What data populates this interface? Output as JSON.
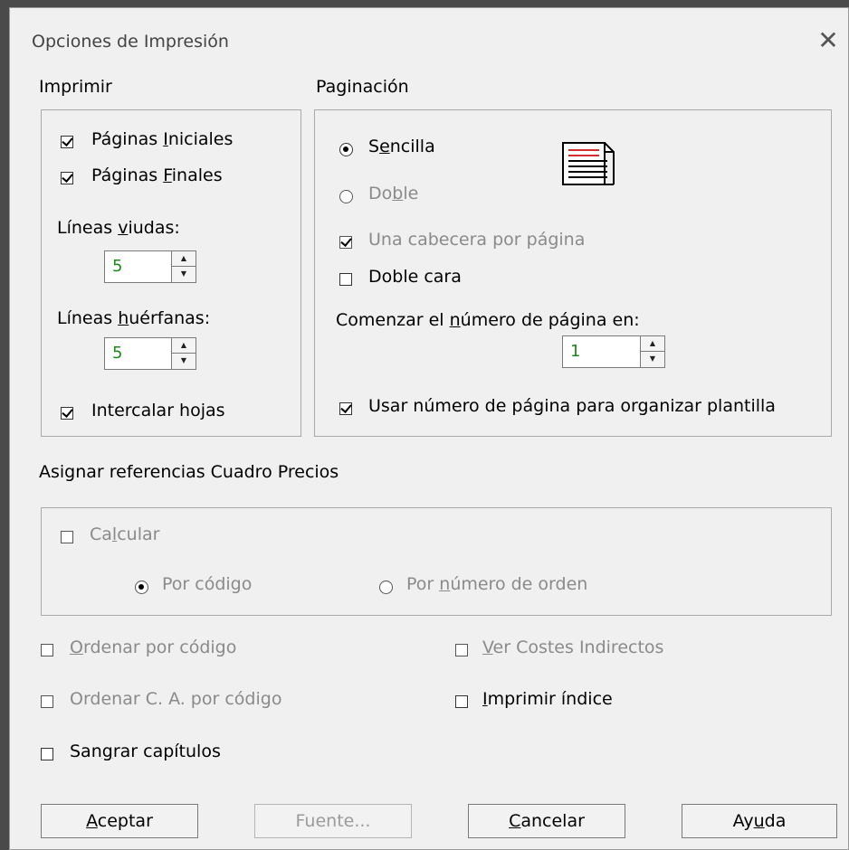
{
  "dialog": {
    "title": "Opciones de Impresión",
    "close_glyph": "✕"
  },
  "imprimir": {
    "group_label": "Imprimir",
    "paginas_iniciales": {
      "pre": "Páginas ",
      "key": "I",
      "post": "niciales",
      "checked": true
    },
    "paginas_finales": {
      "pre": "Páginas ",
      "key": "F",
      "post": "inales",
      "checked": true
    },
    "lineas_viudas": {
      "pre": "Líneas ",
      "key": "v",
      "post": "iudas:",
      "value": "5"
    },
    "lineas_huerfanas": {
      "pre": "Líneas ",
      "key": "h",
      "post": "uérfanas:",
      "value": "5"
    },
    "intercalar_hojas": {
      "label": "Intercalar hojas",
      "checked": true
    }
  },
  "paginacion": {
    "group_label": "Paginación",
    "sencilla": {
      "pre": "S",
      "key": "e",
      "post": "ncilla",
      "selected": true
    },
    "doble": {
      "pre": "Do",
      "key": "b",
      "post": "le",
      "selected": false
    },
    "una_cabecera": {
      "label": "Una cabecera por página",
      "checked": true
    },
    "doble_cara": {
      "label": "Doble cara",
      "checked": false
    },
    "comenzar": {
      "pre": "Comenzar el ",
      "key": "n",
      "post": "úmero de página en:",
      "value": "1"
    },
    "usar_numero": {
      "label": "Usar número de página para organizar plantilla",
      "checked": true
    },
    "icon": "document-icon"
  },
  "asignar": {
    "group_label": "Asignar referencias Cuadro Precios",
    "calcular": {
      "pre": "Ca",
      "key": "l",
      "post": "cular",
      "checked": false
    },
    "por_codigo": {
      "pre": "Por códi",
      "key": "g",
      "post": "o",
      "selected": true
    },
    "por_numero": {
      "pre": "Por ",
      "key": "n",
      "post": "úmero de orden",
      "selected": false
    }
  },
  "options": {
    "ordenar_codigo": {
      "key": "O",
      "post": "rdenar por código",
      "checked": false
    },
    "ordenar_ca": {
      "pre": "Ordenar C. A. por códi",
      "key": "g",
      "post": "o",
      "checked": false
    },
    "sangrar": {
      "pre": "San",
      "key": "g",
      "post": "rar capítulos",
      "checked": false
    },
    "ver_costes": {
      "key": "V",
      "post": "er Costes Indirectos",
      "checked": false
    },
    "imprimir_indice": {
      "key": "I",
      "post": "mprimir índice",
      "checked": false
    }
  },
  "buttons": {
    "aceptar": {
      "key": "A",
      "post": "ceptar"
    },
    "fuente": {
      "label": "Fuente..."
    },
    "cancelar": {
      "key": "C",
      "post": "ancelar"
    },
    "ayuda": {
      "pre": "Ay",
      "key": "u",
      "post": "da"
    }
  },
  "colors": {
    "spin_text": "#1a8a1a",
    "disabled_text": "#8a8a8a",
    "icon_red": "#d32f2f"
  }
}
